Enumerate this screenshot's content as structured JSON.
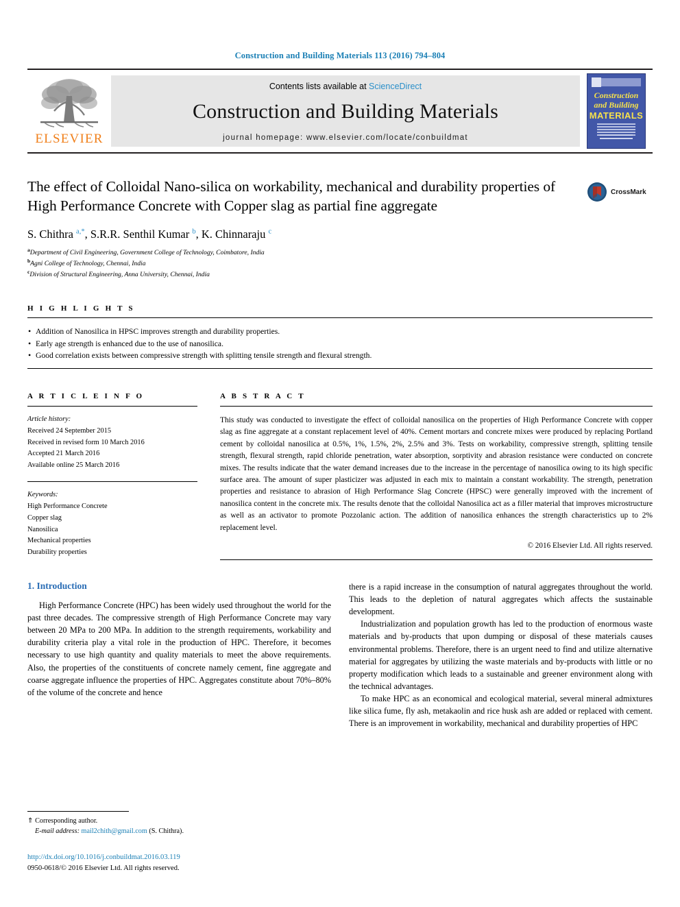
{
  "running_head": "Construction and Building Materials 113 (2016) 794–804",
  "masthead": {
    "publisher_name": "ELSEVIER",
    "contents_prefix": "Contents lists available at ",
    "contents_link": "ScienceDirect",
    "journal_name": "Construction and Building Materials",
    "homepage_label": "journal homepage: www.elsevier.com/locate/conbuildmat",
    "cover": {
      "line1": "Construction",
      "line2": "and Building",
      "line3": "MATERIALS"
    }
  },
  "article": {
    "title": "The effect of Colloidal Nano-silica on workability, mechanical and durability properties of High Performance Concrete with Copper slag as partial fine aggregate",
    "crossmark_label": "CrossMark",
    "authors_html": "S. Chithra <sup>a,*</sup>, S.R.R. Senthil Kumar <sup>b</sup>, K. Chinnaraju <sup>c</sup>",
    "affiliations": [
      {
        "marker": "a",
        "text": "Department of Civil Engineering, Government College of Technology, Coimbatore, India"
      },
      {
        "marker": "b",
        "text": "Agni College of Technology, Chennai, India"
      },
      {
        "marker": "c",
        "text": "Division of Structural Engineering, Anna University, Chennai, India"
      }
    ]
  },
  "highlights": {
    "label": "H I G H L I G H T S",
    "items": [
      "Addition of Nanosilica in HPSC improves strength and durability properties.",
      "Early age strength is enhanced due to the use of nanosilica.",
      "Good correlation exists between compressive strength with splitting tensile strength and flexural strength."
    ]
  },
  "article_info": {
    "label": "A R T I C L E    I N F O",
    "history_label": "Article history:",
    "history": [
      "Received 24 September 2015",
      "Received in revised form 10 March 2016",
      "Accepted 21 March 2016",
      "Available online 25 March 2016"
    ],
    "keywords_label": "Keywords:",
    "keywords": [
      "High Performance Concrete",
      "Copper slag",
      "Nanosilica",
      "Mechanical properties",
      "Durability properties"
    ]
  },
  "abstract": {
    "label": "A B S T R A C T",
    "text": "This study was conducted to investigate the effect of colloidal nanosilica on the properties of High Performance Concrete with copper slag as fine aggregate at a constant replacement level of 40%. Cement mortars and concrete mixes were produced by replacing Portland cement by colloidal nanosilica at 0.5%, 1%, 1.5%, 2%, 2.5% and 3%. Tests on workability, compressive strength, splitting tensile strength, flexural strength, rapid chloride penetration, water absorption, sorptivity and abrasion resistance were conducted on concrete mixes. The results indicate that the water demand increases due to the increase in the percentage of nanosilica owing to its high specific surface area. The amount of super plasticizer was adjusted in each mix to maintain a constant workability. The strength, penetration properties and resistance to abrasion of High Performance Slag Concrete (HPSC) were generally improved with the increment of nanosilica content in the concrete mix. The results denote that the colloidal Nanosilica act as a filler material that improves microstructure as well as an activator to promote Pozzolanic action. The addition of nanosilica enhances the strength characteristics up to 2% replacement level.",
    "copyright": "© 2016 Elsevier Ltd. All rights reserved."
  },
  "body": {
    "section_heading": "1. Introduction",
    "left_paragraphs": [
      "High Performance Concrete (HPC) has been widely used throughout the world for the past three decades. The compressive strength of High Performance Concrete may vary between 20 MPa to 200 MPa. In addition to the strength requirements, workability and durability criteria play a vital role in the production of HPC. Therefore, it becomes necessary to use high quantity and quality materials to meet the above requirements. Also, the properties of the constituents of concrete namely cement, fine aggregate and coarse aggregate influence the properties of HPC. Aggregates constitute about 70%–80% of the volume of the concrete and hence"
    ],
    "right_paragraphs": [
      "there is a rapid increase in the consumption of natural aggregates throughout the world. This leads to the depletion of natural aggregates which affects the sustainable development.",
      "Industrialization and population growth has led to the production of enormous waste materials and by-products that upon dumping or disposal of these materials causes environmental problems. Therefore, there is an urgent need to find and utilize alternative material for aggregates by utilizing the waste materials and by-products with little or no property modification which leads to a sustainable and greener environment along with the technical advantages.",
      "To make HPC as an economical and ecological material, several mineral admixtures like silica fume, fly ash, metakaolin and rice husk ash are added or replaced with cement. There is an improvement in workability, mechanical and durability properties of HPC"
    ]
  },
  "footer": {
    "corresponding_marker": "⇑",
    "corresponding_label": " Corresponding author.",
    "email_label": "E-mail address:",
    "email": "mail2chith@gmail.com",
    "email_owner": "(S. Chithra).",
    "doi": "http://dx.doi.org/10.1016/j.conbuildmat.2016.03.119",
    "issn_line": "0950-0618/© 2016 Elsevier Ltd. All rights reserved."
  },
  "colors": {
    "link": "#1a7fb5",
    "heading": "#2a6db5",
    "elsevier_orange": "#f07f1a",
    "cover_blue": "#4257a8"
  }
}
